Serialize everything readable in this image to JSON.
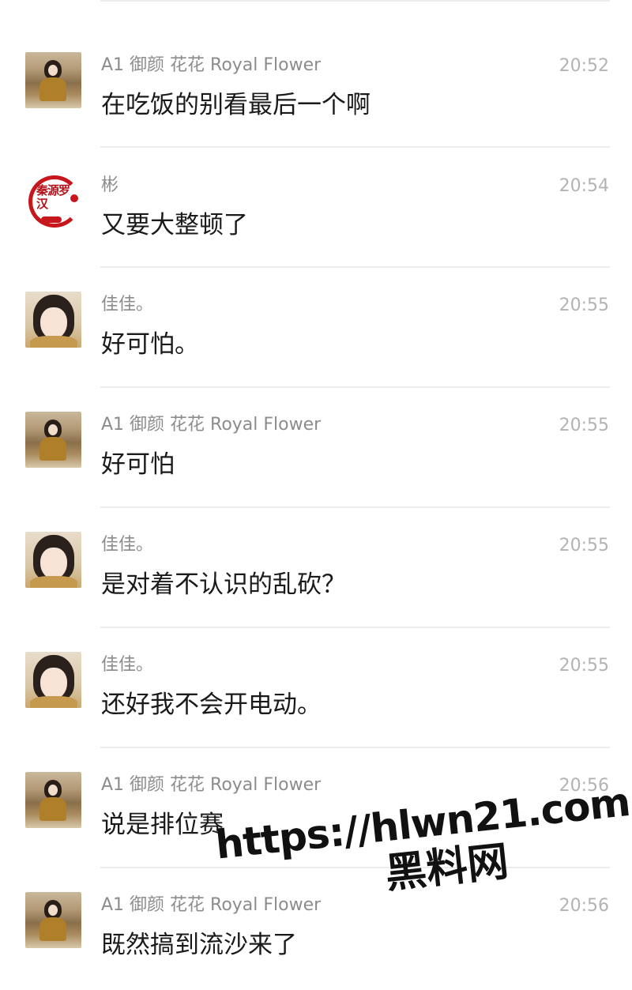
{
  "messages": [
    {
      "avatar": "girl-dancing-avatar",
      "name": "A1 御颜  花花 Royal Flower",
      "time": "20:52",
      "text": "在吃饭的别看最后一个啊"
    },
    {
      "avatar": "qinyuan-luohan-logo-avatar",
      "name": "彬",
      "time": "20:54",
      "text": "又要大整顿了"
    },
    {
      "avatar": "girl-portrait-avatar",
      "name": "佳佳。",
      "time": "20:55",
      "text": "好可怕。"
    },
    {
      "avatar": "girl-dancing-avatar",
      "name": "A1 御颜  花花 Royal Flower",
      "time": "20:55",
      "text": "好可怕"
    },
    {
      "avatar": "girl-portrait-avatar",
      "name": "佳佳。",
      "time": "20:55",
      "text": "是对着不认识的乱砍？"
    },
    {
      "avatar": "girl-portrait-avatar",
      "name": "佳佳。",
      "time": "20:55",
      "text": "还好我不会开电动。"
    },
    {
      "avatar": "girl-dancing-avatar",
      "name": "A1 御颜  花花 Royal Flower",
      "time": "20:56",
      "text": "说是排位赛"
    },
    {
      "avatar": "girl-dancing-avatar",
      "name": "A1 御颜  花花 Royal Flower",
      "time": "20:56",
      "text": "既然搞到流沙来了"
    }
  ],
  "logo_text": "秦源罗汉",
  "watermark": {
    "url": "https://hlwn21.com",
    "label": "黑料网"
  }
}
